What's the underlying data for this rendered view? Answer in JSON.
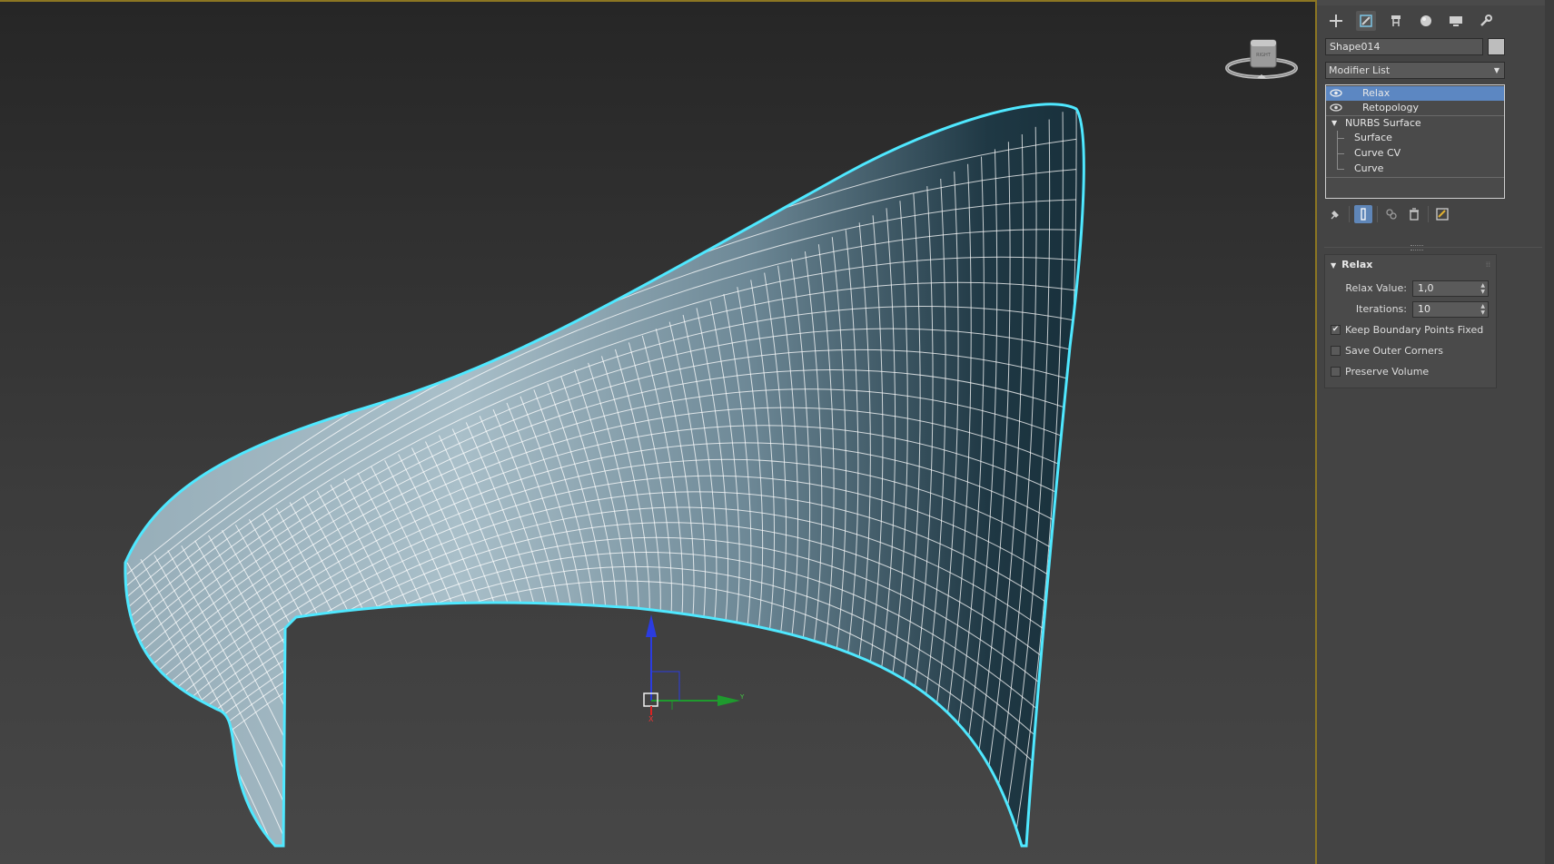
{
  "command_panel": {
    "tabs": [
      {
        "name": "create",
        "icon": "plus-icon"
      },
      {
        "name": "modify",
        "icon": "modify-icon",
        "active": true
      },
      {
        "name": "hierarchy",
        "icon": "hierarchy-icon"
      },
      {
        "name": "motion",
        "icon": "motion-icon"
      },
      {
        "name": "display",
        "icon": "display-icon"
      },
      {
        "name": "utilities",
        "icon": "wrench-icon"
      }
    ],
    "object_name": "Shape014",
    "object_color": "#bdbdbd",
    "modifier_list": {
      "selected": "Modifier List"
    },
    "stack": {
      "modifiers": [
        {
          "label": "Relax",
          "visible": true,
          "selected": true
        },
        {
          "label": "Retopology",
          "visible": true,
          "selected": false
        }
      ],
      "base": {
        "label": "NURBS Surface",
        "children": [
          "Surface",
          "Curve CV",
          "Curve"
        ]
      }
    }
  },
  "rollout": {
    "title": "Relax",
    "relax_value_label": "Relax Value:",
    "relax_value": "1,0",
    "iterations_label": "Iterations:",
    "iterations": "10",
    "checkboxes": [
      {
        "label": "Keep Boundary Points Fixed",
        "checked": true
      },
      {
        "label": "Save Outer Corners",
        "checked": false
      },
      {
        "label": "Preserve Volume",
        "checked": false
      }
    ]
  },
  "viewport": {
    "viewcube_label": "RIGHT",
    "gizmo": {
      "x_label": "X",
      "y_label": "Y"
    },
    "selection_color": "#4fe8ff",
    "border_color": "#8c7622"
  }
}
